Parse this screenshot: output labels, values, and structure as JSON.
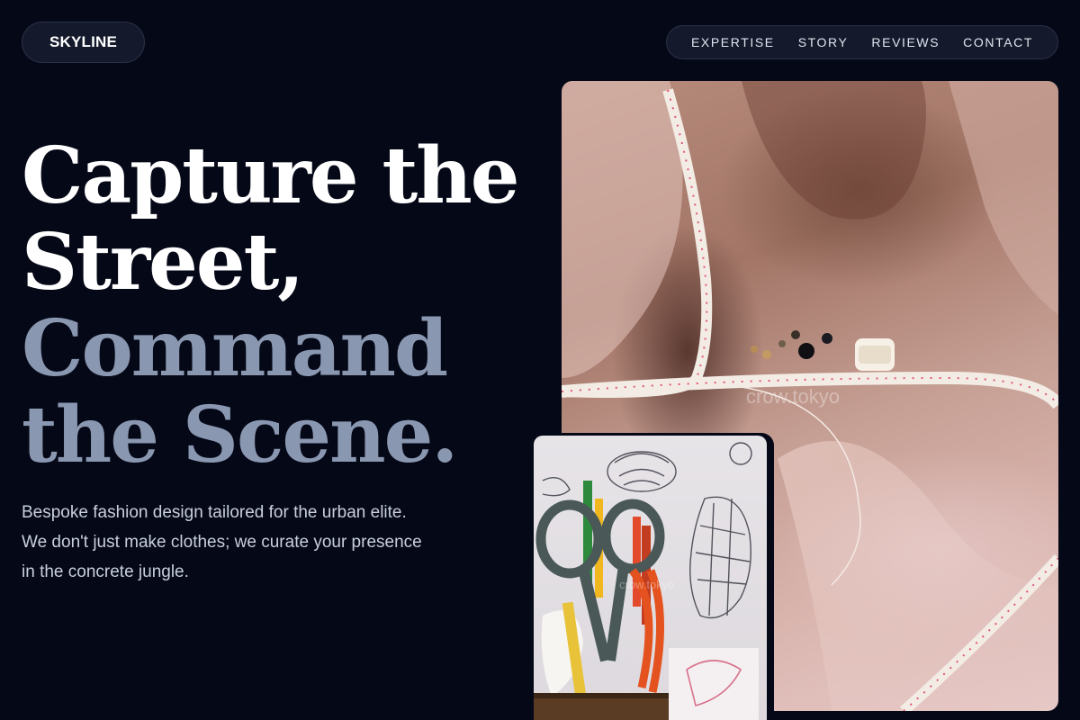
{
  "header": {
    "logo": "SKYLINE",
    "nav": [
      "EXPERTISE",
      "STORY",
      "REVIEWS",
      "CONTACT"
    ]
  },
  "hero": {
    "title_lines_primary": [
      "Capture the",
      "Street,"
    ],
    "title_lines_accent": [
      "Command",
      "the Scene."
    ],
    "description_lines": [
      "Bespoke fashion design tailored for the urban elite.",
      "We don't just make clothes; we curate your presence",
      "in the concrete jungle."
    ]
  },
  "images": {
    "main": {
      "subject": "silk fabric with measuring tape, beads and thread spool",
      "watermark": "crow.tokyo"
    },
    "secondary": {
      "subject": "scissors, pencils and fashion sketches",
      "watermark": "crow.tokyo"
    }
  },
  "colors": {
    "background": "#050817",
    "pill": "#141a2b",
    "accent_text": "#8a97b0",
    "body_text": "#c8cfdd"
  }
}
